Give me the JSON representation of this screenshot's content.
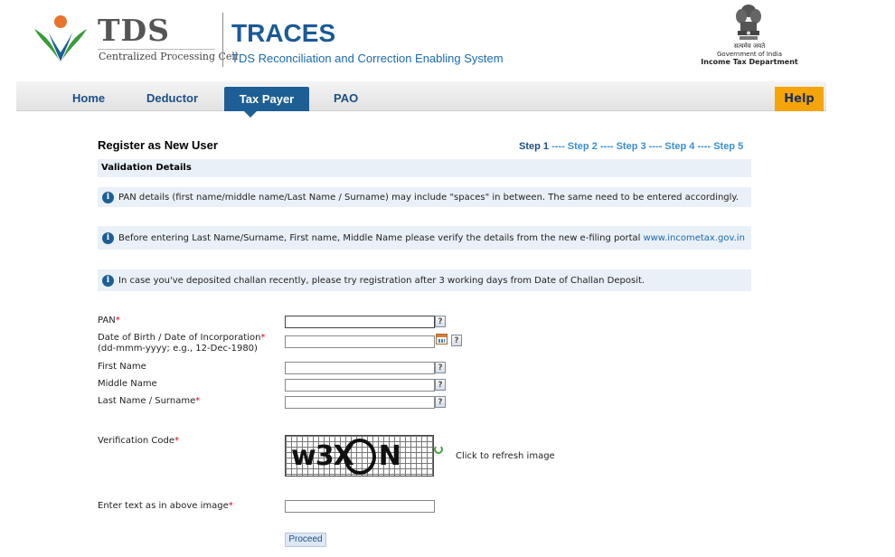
{
  "header": {
    "logo_text": "TDS",
    "logo_subtitle": "Centralized Processing Cell",
    "app_title": "TRACES",
    "app_subtitle": "TDS Reconciliation and Correction Enabling System",
    "gov_hindi": "सत्यमेव जयते",
    "gov_line": "Government of India",
    "dept_line": "Income Tax Department",
    "brand_color": "#1a5a96"
  },
  "nav": {
    "items": [
      {
        "label": "Home"
      },
      {
        "label": "Deductor"
      },
      {
        "label": "Tax Payer",
        "active": true
      },
      {
        "label": "PAO"
      }
    ],
    "help_label": "Help",
    "active_color": "#1d5f94",
    "help_color": "#f5a50a"
  },
  "page": {
    "title": "Register as New User",
    "steps": [
      "Step 1",
      "Step 2",
      "Step 3",
      "Step 4",
      "Step 5"
    ],
    "step_separator": "----",
    "section_title": "Validation Details",
    "info": [
      {
        "text": "PAN details (first name/middle name/Last Name / Surname) may include \"spaces\" in between. The same need to be entered accordingly."
      },
      {
        "text": "Before entering Last Name/Surname, First name, Middle Name please verify the details from the new e-filing portal",
        "link": "www.incometax.gov.in"
      },
      {
        "text": "In case you've deposited challan recently, please try registration after 3 working days from Date of Challan Deposit."
      }
    ]
  },
  "form": {
    "pan_label": "PAN",
    "dob_label": "Date of Birth / Date of Incorporation",
    "dob_hint": "(dd-mmm-yyyy; e.g., 12-Dec-1980)",
    "first_name_label": "First Name",
    "middle_name_label": "Middle Name",
    "last_name_label": "Last Name / Surname",
    "verification_label": "Verification Code",
    "captcha_text": "w3X",
    "captcha_tail": "N",
    "refresh_label": "Click to refresh image",
    "enter_text_label": "Enter text as in above image",
    "required_mark": "*",
    "help_glyph": "?",
    "proceed_label": "Proceed"
  }
}
